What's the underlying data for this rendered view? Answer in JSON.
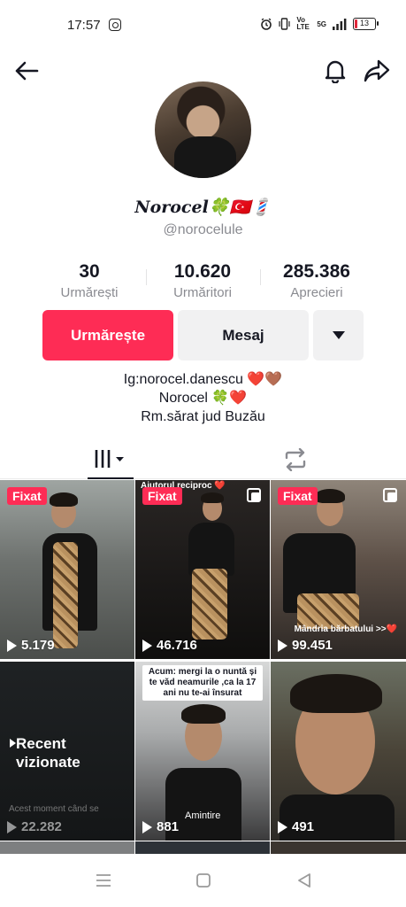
{
  "status_bar": {
    "time": "17:57",
    "network": "Vo LTE",
    "signal": "5G",
    "battery": "13",
    "battery_level": 0.13
  },
  "profile": {
    "display_name": "Norocel🍀🇹🇷💈",
    "username": "@norocelule"
  },
  "stats": [
    {
      "value": "30",
      "label": "Urmărești"
    },
    {
      "value": "10.620",
      "label": "Urmăritori"
    },
    {
      "value": "285.386",
      "label": "Aprecieri"
    }
  ],
  "actions": {
    "follow_label": "Urmărește",
    "message_label": "Mesaj"
  },
  "bio": [
    "Ig:norocel.danescu ❤️🤎",
    "Norocel 🍀❤️",
    "Rm.sărat jud Buzău"
  ],
  "videos": [
    {
      "pinned": "Fixat",
      "views": "5.179"
    },
    {
      "pinned": "Fixat",
      "views": "46.716",
      "caption": "Ajutorul reciproc ❤️"
    },
    {
      "pinned": "Fixat",
      "views": "99.451",
      "caption": "Mândria bărbatului >>❤️"
    },
    {
      "recent": "Recent vizionate",
      "views": "22.282",
      "faded_text": "Acest moment când se"
    },
    {
      "views": "881",
      "overlay": "Acum: mergi la o nuntă și te văd neamurile ,ca la 17 ani nu te-ai însurat",
      "memory": "Amintire"
    },
    {
      "views": "491"
    }
  ],
  "icons": {
    "back": "arrow-left-icon",
    "bell": "bell-icon",
    "share": "share-icon",
    "more": "triangle-down-icon",
    "videos_tab": "grid-icon",
    "reposts_tab": "repost-icon"
  },
  "colors": {
    "accent": "#fe2c55",
    "text": "#161823",
    "muted": "#8a8b91",
    "button_bg": "#f1f1f2"
  }
}
